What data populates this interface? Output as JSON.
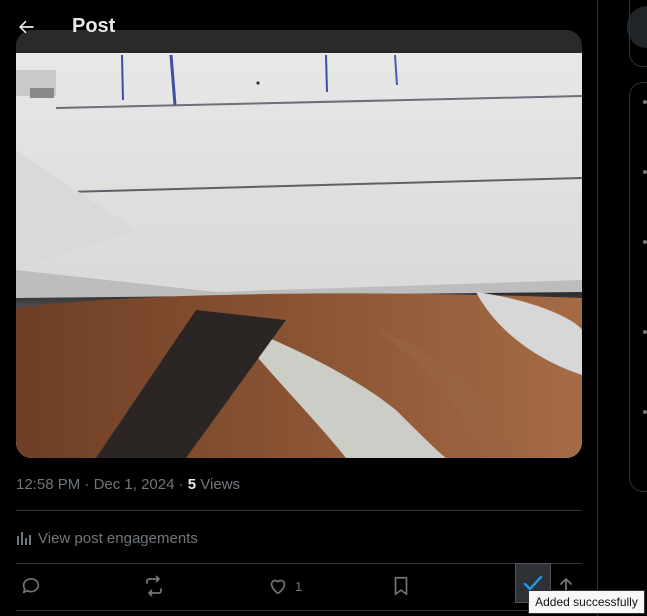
{
  "header": {
    "title": "Post"
  },
  "post": {
    "time": "12:58 PM",
    "separator1": " · ",
    "date": "Dec 1, 2024",
    "separator2": " · ",
    "views_count": "5",
    "views_label": " Views"
  },
  "engagements": {
    "label": "View post engagements"
  },
  "actions": {
    "like_count": "1"
  },
  "toast": {
    "text": "Added successfully"
  },
  "colors": {
    "background": "#000000",
    "text_primary": "#e7e9ea",
    "text_secondary": "#71767b",
    "divider": "#2f3336",
    "accent_blue": "#1d9bf0"
  },
  "icons": {
    "back": "arrow-left-icon",
    "engagements": "bar-chart-icon",
    "reply": "reply-icon",
    "repost": "repost-icon",
    "like": "heart-icon",
    "bookmark": "bookmark-icon",
    "check": "check-icon",
    "share": "share-icon"
  }
}
